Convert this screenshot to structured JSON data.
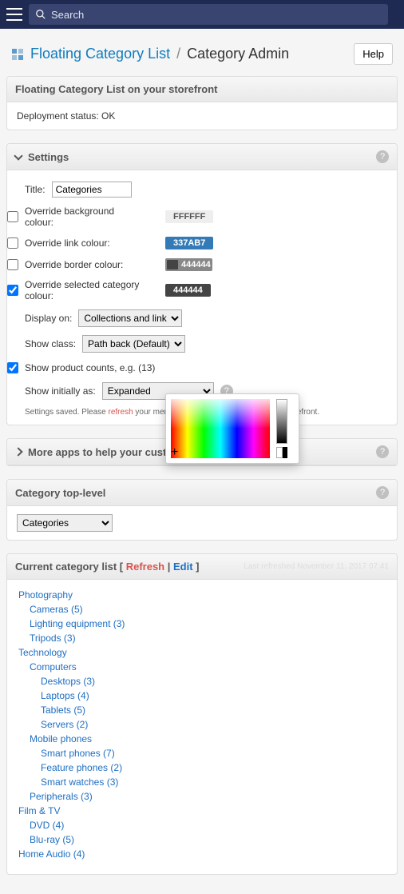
{
  "topbar": {
    "search_placeholder": "Search"
  },
  "breadcrumb": {
    "link": "Floating Category List",
    "current": "Category Admin",
    "help": "Help"
  },
  "status_panel": {
    "title": "Floating Category List on your storefront",
    "body": "Deployment status: OK"
  },
  "settings": {
    "title": "Settings",
    "title_label": "Title:",
    "title_value": "Categories",
    "override_bg": "Override background colour:",
    "bg_swatch": "FFFFFF",
    "override_link": "Override link colour:",
    "link_swatch": "337AB7",
    "override_border": "Override border colour:",
    "border_swatch": "444444",
    "override_sel": "Override selected category colour:",
    "sel_swatch": "444444",
    "display_on": "Display on:",
    "display_on_value": "Collections and linked pages",
    "show_class": "Show class:",
    "show_class_value": "Path back (Default)",
    "show_counts": "Show product counts, e.g. (13)",
    "show_initially": "Show initially as:",
    "show_initially_value": "Expanded",
    "note_pre": "Settings saved. Please ",
    "note_ref": "refresh",
    "note_post": " your menu to apply these settings to your storefront."
  },
  "more_apps": {
    "title": "More apps to help your customers"
  },
  "top_level": {
    "title": "Category top-level",
    "value": "Categories"
  },
  "catlist_hd": {
    "pre": "Current category list [ ",
    "refresh": "Refresh",
    "sep": " | ",
    "edit": "Edit",
    "post": " ]",
    "last": "Last refreshed November 11, 2017 07:41"
  },
  "categories": [
    {
      "t": "Photography",
      "l": 1
    },
    {
      "t": "Cameras (5)",
      "l": 2
    },
    {
      "t": "Lighting equipment (3)",
      "l": 2
    },
    {
      "t": "Tripods (3)",
      "l": 2
    },
    {
      "t": "Technology",
      "l": 1
    },
    {
      "t": "Computers",
      "l": 2
    },
    {
      "t": "Desktops (3)",
      "l": 3
    },
    {
      "t": "Laptops (4)",
      "l": 3
    },
    {
      "t": "Tablets (5)",
      "l": 3
    },
    {
      "t": "Servers (2)",
      "l": 3
    },
    {
      "t": "Mobile phones",
      "l": 2
    },
    {
      "t": "Smart phones (7)",
      "l": 3
    },
    {
      "t": "Feature phones (2)",
      "l": 3
    },
    {
      "t": "Smart watches (3)",
      "l": 3
    },
    {
      "t": "Peripherals (3)",
      "l": 2
    },
    {
      "t": "Film & TV",
      "l": 1
    },
    {
      "t": "DVD (4)",
      "l": 2
    },
    {
      "t": "Blu-ray (5)",
      "l": 2
    },
    {
      "t": "Home Audio (4)",
      "l": 1
    }
  ]
}
